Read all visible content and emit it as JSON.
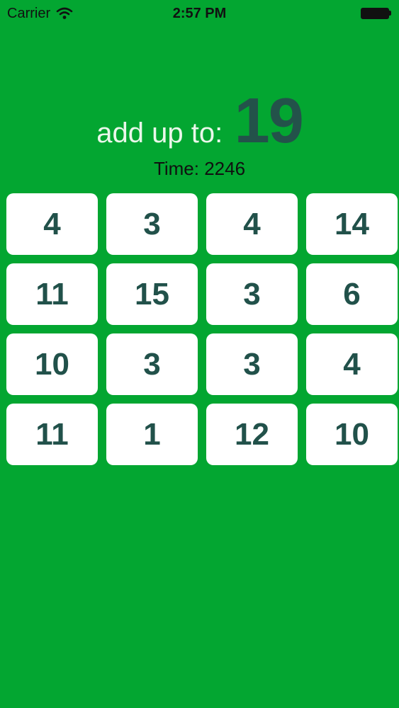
{
  "status_bar": {
    "carrier": "Carrier",
    "time": "2:57 PM"
  },
  "game": {
    "prompt": "add up to:",
    "target": "19",
    "timer": "Time: 2246"
  },
  "grid": {
    "rows": [
      [
        "4",
        "3",
        "4",
        "14"
      ],
      [
        "11",
        "15",
        "3",
        "6"
      ],
      [
        "10",
        "3",
        "3",
        "4"
      ],
      [
        "11",
        "1",
        "12",
        "10"
      ]
    ]
  },
  "colors": {
    "background": "#03A631",
    "tile": "#FFFFFF",
    "tile_text": "#21514A",
    "target_text": "#23524A"
  }
}
